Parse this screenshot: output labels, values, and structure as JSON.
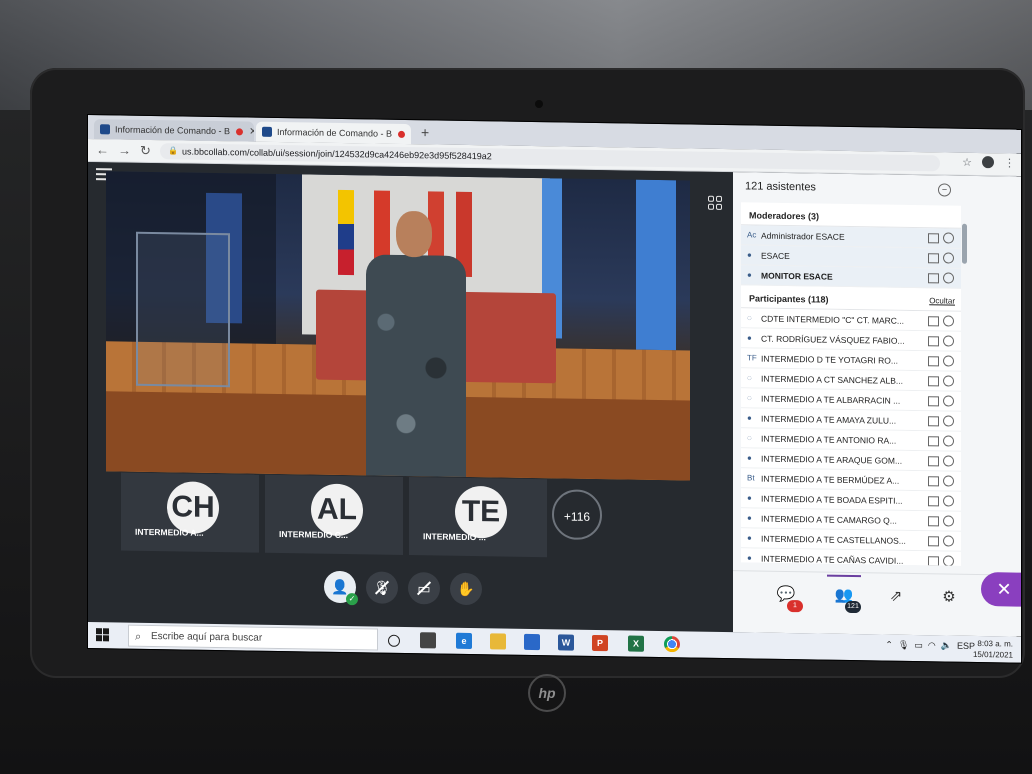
{
  "browser": {
    "tabs": [
      {
        "title": "Información de Comando - B"
      },
      {
        "title": "Información de Comando - B"
      }
    ],
    "url": "us.bbcollab.com/collab/ui/session/join/124532d9ca4246eb92e3d95f528419a2"
  },
  "session": {
    "thumbnails": [
      {
        "initials": "CH",
        "label": "INTERMEDIO A..."
      },
      {
        "initials": "AL",
        "label": "INTERMEDIO C..."
      },
      {
        "initials": "TE",
        "label": "INTERMEDIO ..."
      }
    ],
    "more_count": "+116"
  },
  "panel": {
    "title": "121 asistentes",
    "moderators_header": "Moderadores (3)",
    "moderators": [
      {
        "icon": "Ac",
        "name": "Administrador ESACE"
      },
      {
        "icon": "●",
        "name": "ESACE"
      },
      {
        "icon": "●",
        "name": "MONITOR ESACE"
      }
    ],
    "participants_header": "Participantes (118)",
    "hide_label": "Ocultar",
    "participants": [
      {
        "icon": "◌",
        "name": "CDTE INTERMEDIO \"C\" CT. MARC..."
      },
      {
        "icon": "●",
        "name": "CT. RODRÍGUEZ VÁSQUEZ FABIO..."
      },
      {
        "icon": "TF",
        "name": "INTERMEDIO D TE YOTAGRI RO..."
      },
      {
        "icon": "◌",
        "name": "INTERMEDIO A CT SANCHEZ ALB..."
      },
      {
        "icon": "◌",
        "name": "INTERMEDIO A TE ALBARRACIN ..."
      },
      {
        "icon": "●",
        "name": "INTERMEDIO A TE AMAYA ZULU..."
      },
      {
        "icon": "◌",
        "name": "INTERMEDIO A TE ANTONIO RA..."
      },
      {
        "icon": "●",
        "name": "INTERMEDIO A TE ARAQUE GOM..."
      },
      {
        "icon": "Bt",
        "name": "INTERMEDIO A TE BERMÚDEZ A..."
      },
      {
        "icon": "●",
        "name": "INTERMEDIO A TE BOADA ESPITI..."
      },
      {
        "icon": "●",
        "name": "INTERMEDIO A TE CAMARGO Q..."
      },
      {
        "icon": "●",
        "name": "INTERMEDIO A TE CASTELLANOS..."
      },
      {
        "icon": "●",
        "name": "INTERMEDIO A TE CAÑAS CAVIDI..."
      }
    ],
    "footer": {
      "chat_badge": "1",
      "attendees_badge": "121"
    }
  },
  "taskbar": {
    "search_placeholder": "Escribe aquí para buscar",
    "language": "ESP",
    "time": "8:03 a. m.",
    "date": "15/01/2021"
  },
  "colors": {
    "accent_purple": "#8a3fbf",
    "badge_red": "#d9302c",
    "video_floor": "#b97438"
  }
}
